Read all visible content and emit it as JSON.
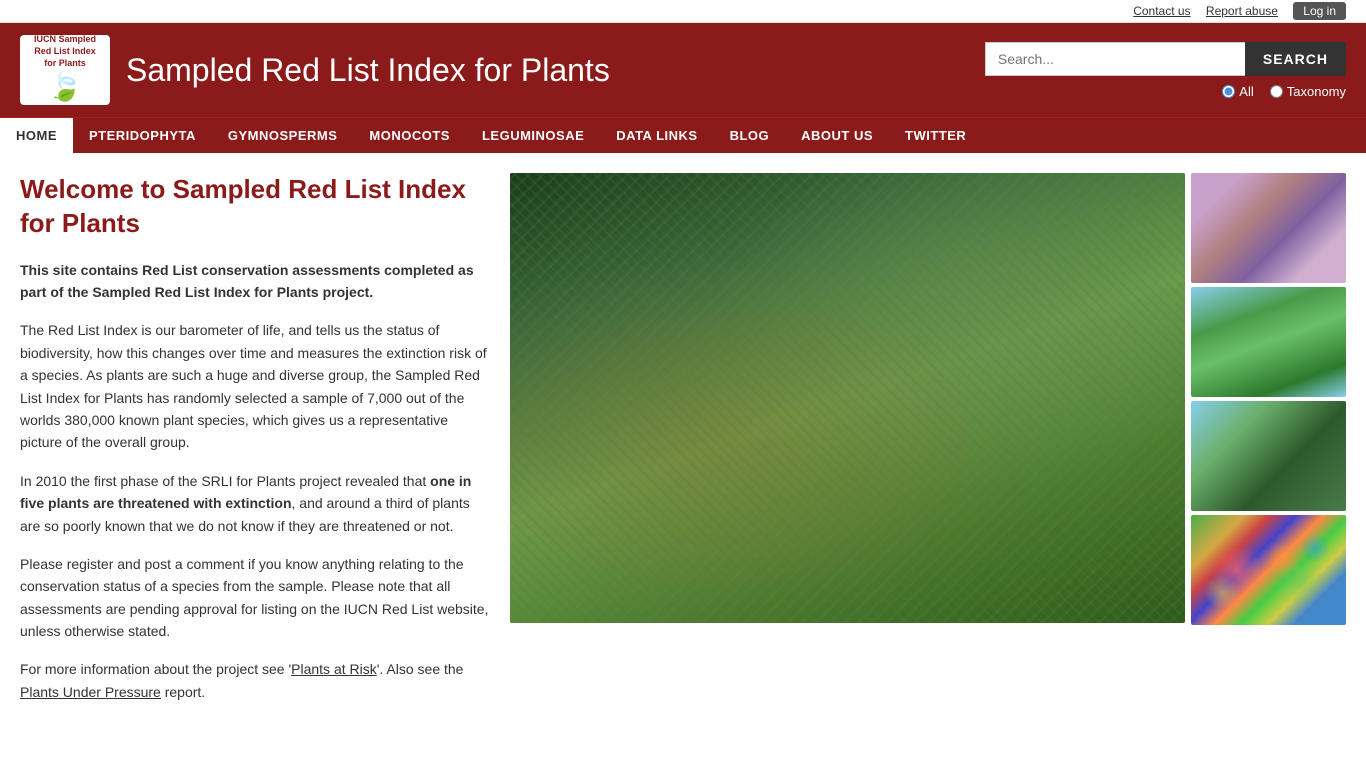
{
  "topbar": {
    "contact_us": "Contact us",
    "report_abuse": "Report abuse",
    "log_in": "Log in"
  },
  "header": {
    "logo_line1": "IUCN Sampled",
    "logo_line2": "Red List Index",
    "logo_line3": "for Plants",
    "site_title": "Sampled Red List Index for Plants",
    "search_placeholder": "Search...",
    "search_btn": "SEARCH",
    "radio_all": "All",
    "radio_taxonomy": "Taxonomy"
  },
  "nav": {
    "items": [
      {
        "label": "HOME",
        "active": true
      },
      {
        "label": "PTERIDOPHYTA",
        "active": false
      },
      {
        "label": "GYMNOSPERMS",
        "active": false
      },
      {
        "label": "MONOCOTS",
        "active": false
      },
      {
        "label": "LEGUMINOSAE",
        "active": false
      },
      {
        "label": "DATA LINKS",
        "active": false
      },
      {
        "label": "BLOG",
        "active": false
      },
      {
        "label": "ABOUT US",
        "active": false
      },
      {
        "label": "TWITTER",
        "active": false
      }
    ]
  },
  "main": {
    "page_heading": "Welcome to Sampled Red List Index for Plants",
    "intro_bold": "This site contains Red List conservation assessments completed as part of the Sampled Red List Index for Plants project.",
    "para1": "The Red List Index is our barometer of life, and tells us the status of biodiversity, how this changes over time and measures the extinction risk of a species.  As plants are such a huge and diverse group, the Sampled Red List Index for Plants has randomly selected a sample of 7,000 out of the worlds 380,000 known plant species, which gives us a representative picture of the overall group.",
    "para2_start": "In 2010 the first phase of the SRLI for Plants project revealed that ",
    "para2_bold": "one in five plants are threatened with extinction",
    "para2_end": ", and around a third of plants are so poorly known that we do not know if they are threatened or not.",
    "para3": "Please register and post a comment if you know anything relating to the conservation status of a species from the sample. Please note that all assessments are pending approval for listing on the IUCN Red List website, unless otherwise stated.",
    "para4_start": "For more information about the project see '",
    "link1": "Plants at Risk",
    "para4_mid": "'. Also see the ",
    "link2": "Plants Under Pressure",
    "para4_end": " report."
  }
}
